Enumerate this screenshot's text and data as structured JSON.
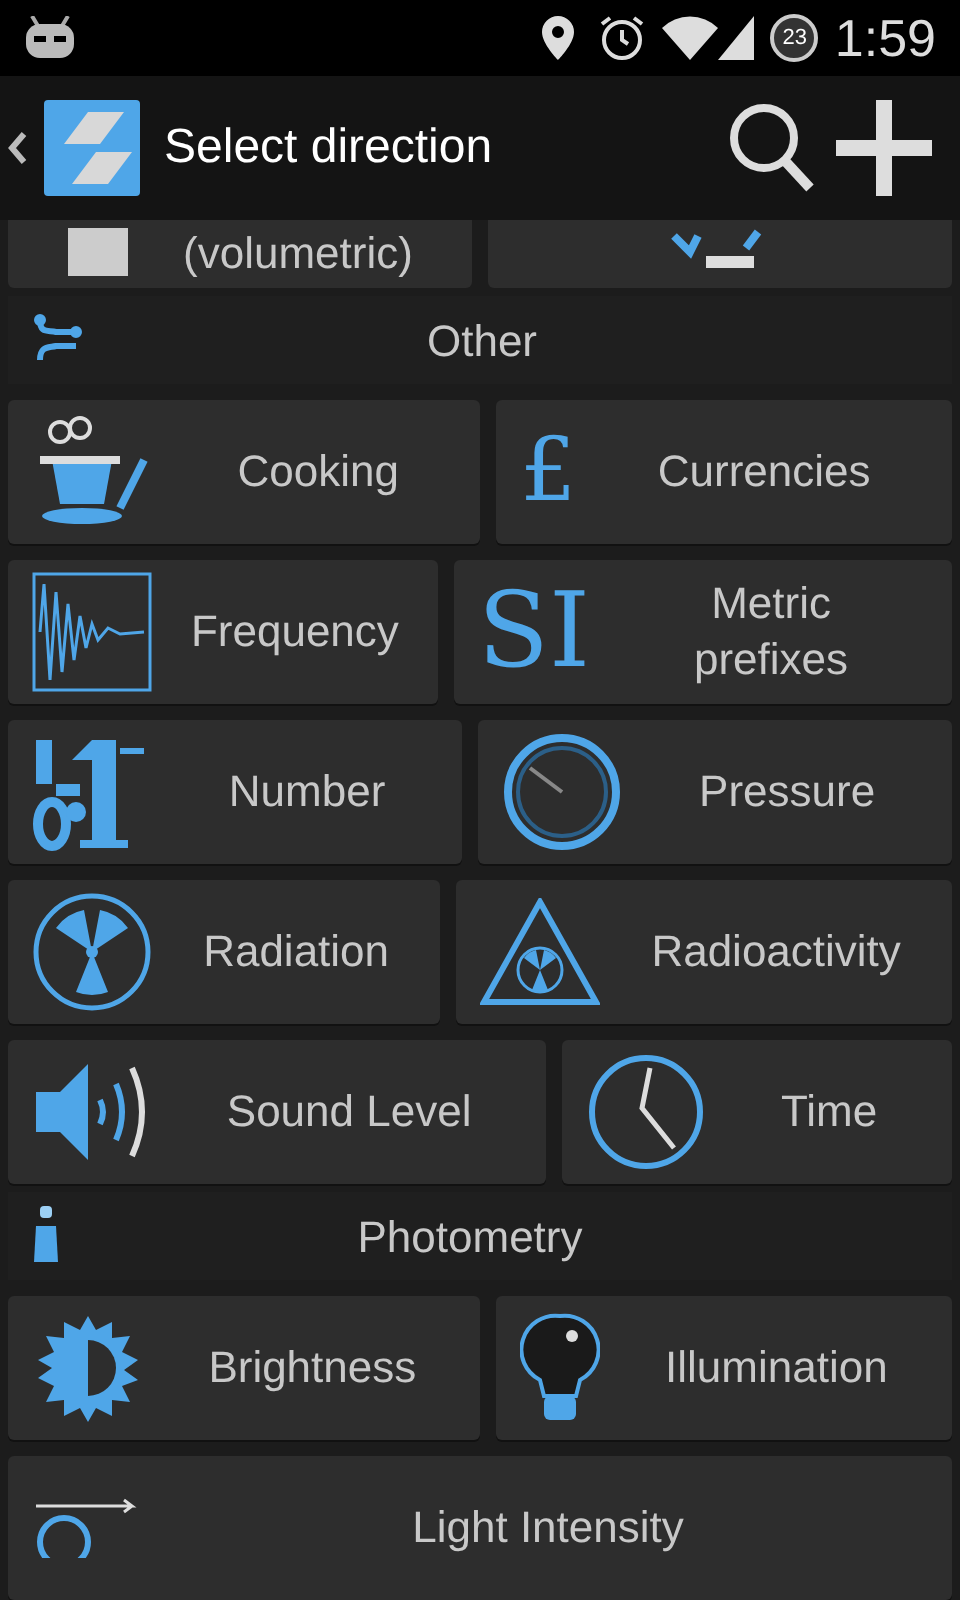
{
  "status_bar": {
    "time": "1:59",
    "notification_count": "23"
  },
  "action_bar": {
    "title": "Select direction"
  },
  "partial_row": {
    "label": "(volumetric)"
  },
  "sections": [
    {
      "title": "Other",
      "rows": [
        [
          {
            "label": "Cooking"
          },
          {
            "glyph": "£",
            "label": "Currencies"
          }
        ],
        [
          {
            "label": "Frequency"
          },
          {
            "glyph": "SI",
            "label": "Metric prefixes"
          }
        ],
        [
          {
            "label": "Number"
          },
          {
            "label": "Pressure"
          }
        ],
        [
          {
            "label": "Radiation"
          },
          {
            "label": "Radioactivity"
          }
        ],
        [
          {
            "label": "Sound Level"
          },
          {
            "label": "Time"
          }
        ]
      ]
    },
    {
      "title": "Photometry",
      "rows": [
        [
          {
            "label": "Brightness"
          },
          {
            "label": "Illumination"
          }
        ],
        [
          {
            "label": "Light Intensity"
          }
        ]
      ]
    }
  ]
}
